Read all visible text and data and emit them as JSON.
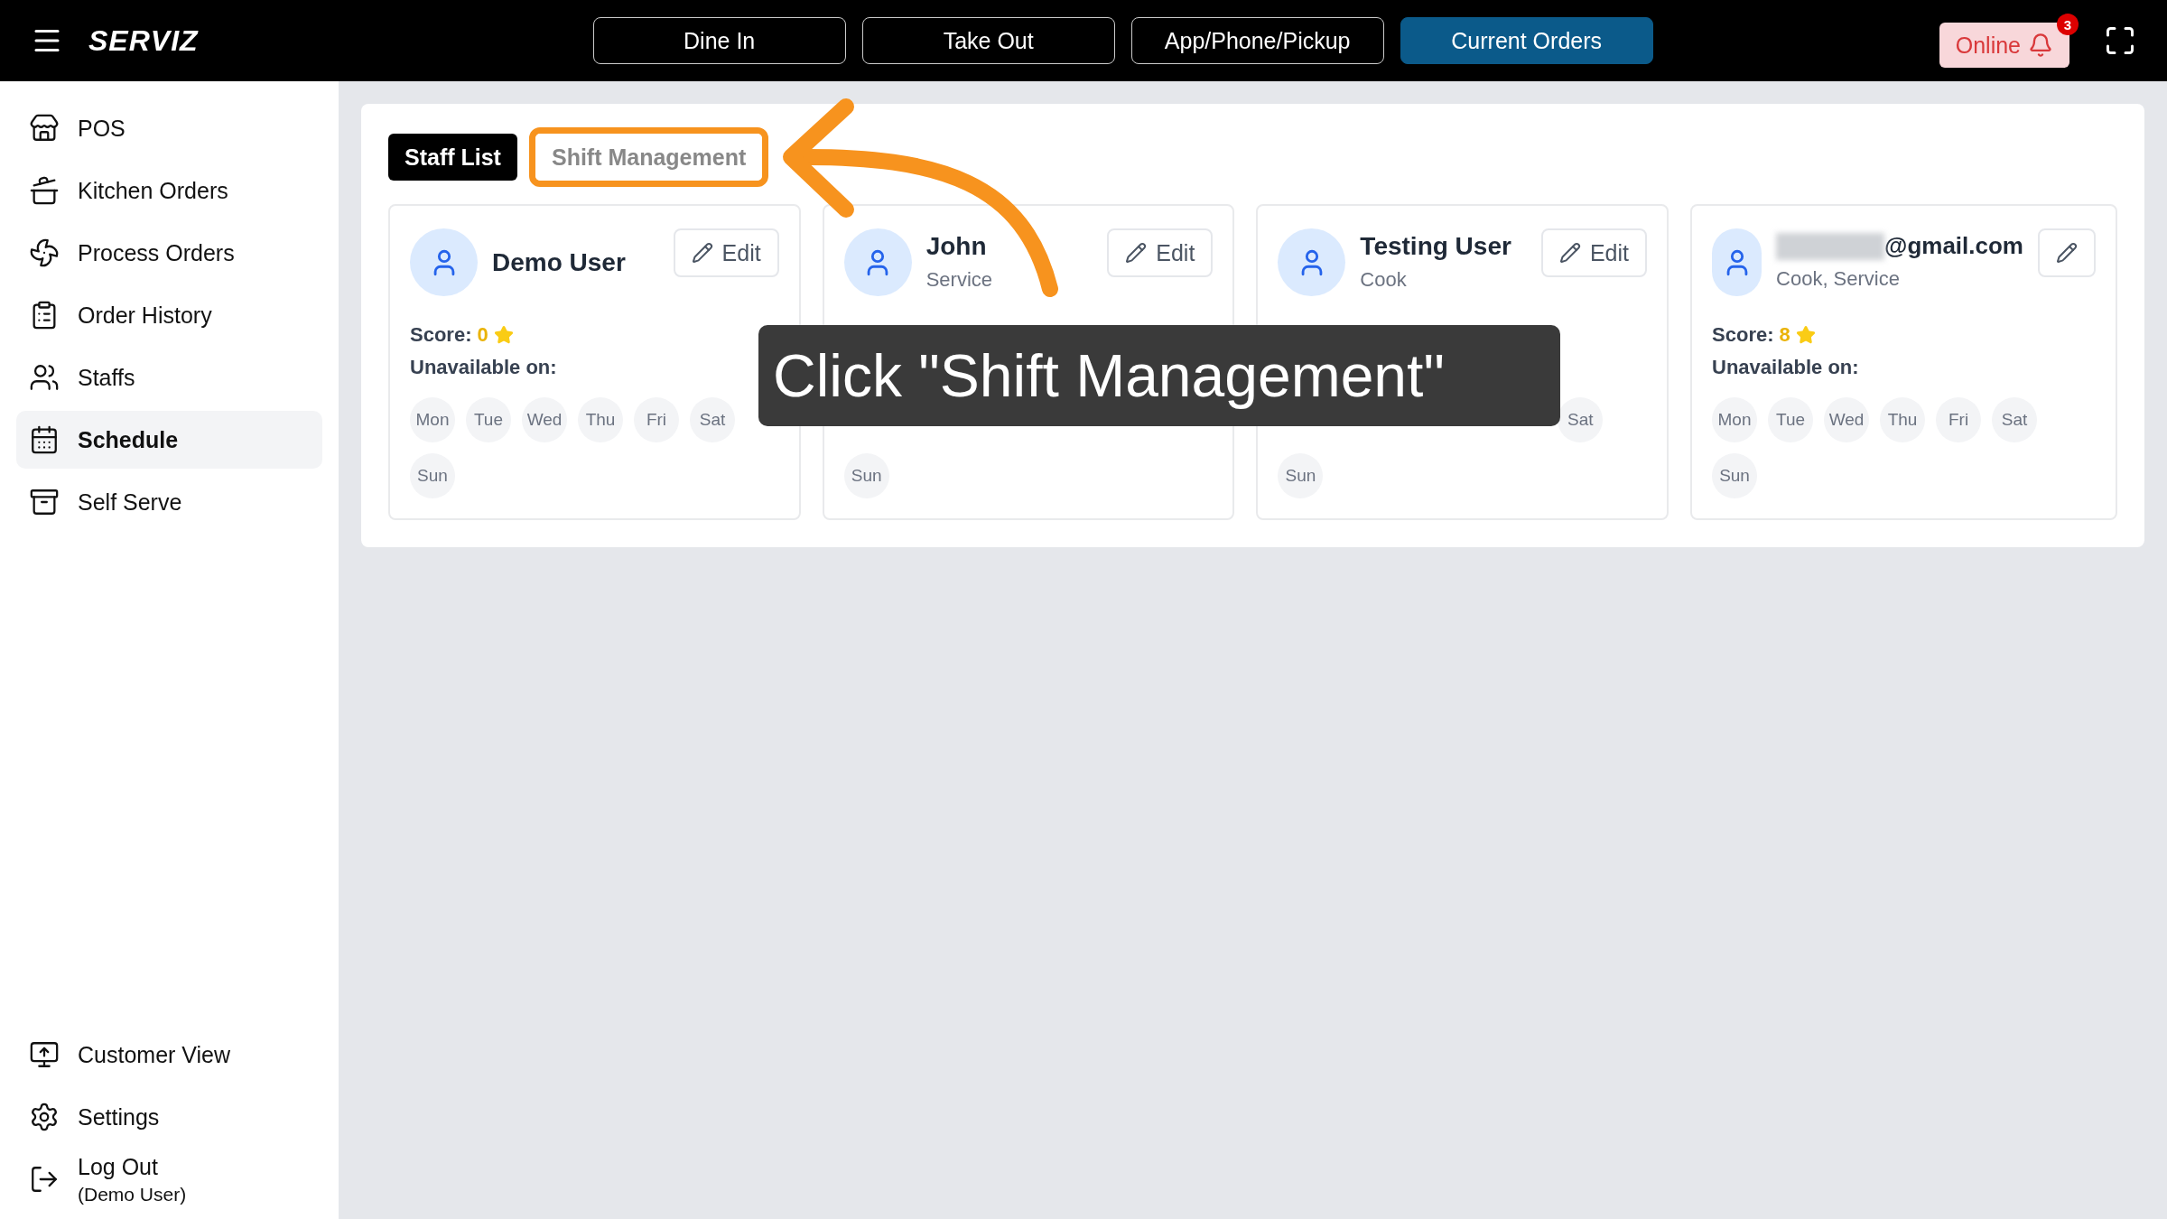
{
  "header": {
    "brand": "SERVIZ",
    "order_types": [
      {
        "label": "Dine In",
        "selected": false
      },
      {
        "label": "Take Out",
        "selected": false
      },
      {
        "label": "App/Phone/Pickup",
        "selected": false
      },
      {
        "label": "Current Orders",
        "selected": true
      }
    ],
    "status": "Online",
    "notification_count": "3"
  },
  "sidebar": {
    "items": [
      {
        "label": "POS",
        "selected": false
      },
      {
        "label": "Kitchen Orders",
        "selected": false
      },
      {
        "label": "Process Orders",
        "selected": false
      },
      {
        "label": "Order History",
        "selected": false
      },
      {
        "label": "Staffs",
        "selected": false
      },
      {
        "label": "Schedule",
        "selected": true
      },
      {
        "label": "Self Serve",
        "selected": false
      }
    ],
    "footer": [
      {
        "label": "Customer View"
      },
      {
        "label": "Settings"
      },
      {
        "label": "Log Out",
        "sublabel": "(Demo User)"
      }
    ]
  },
  "tabs": [
    {
      "label": "Staff List",
      "selected": true,
      "highlighted": false
    },
    {
      "label": "Shift Management",
      "selected": false,
      "highlighted": true
    }
  ],
  "staff": [
    {
      "name": "Demo User",
      "redacted": false,
      "score_label": "Score:",
      "score": "0",
      "unavailable_label": "Unavailable on:",
      "edit": "Edit",
      "days": [
        {
          "label": "Mon",
          "unavailable": false
        },
        {
          "label": "Tue",
          "unavailable": false
        },
        {
          "label": "Wed",
          "unavailable": false
        },
        {
          "label": "Thu",
          "unavailable": false
        },
        {
          "label": "Fri",
          "unavailable": false
        },
        {
          "label": "Sat",
          "unavailable": false
        },
        {
          "label": "Sun",
          "unavailable": false
        }
      ]
    },
    {
      "name": "John",
      "redacted": false,
      "role": "Service",
      "edit": "Edit",
      "days": [
        {
          "label": "Sun",
          "unavailable": false
        }
      ]
    },
    {
      "name": "Testing User",
      "redacted": false,
      "role": "Cook",
      "edit": "Edit",
      "days": [
        {
          "label": "Sat",
          "unavailable": false
        },
        {
          "label": "Sun",
          "unavailable": false
        }
      ]
    },
    {
      "name": "@gmail.com",
      "redacted": true,
      "role": "Cook, Service",
      "score_label": "Score:",
      "score": "8",
      "unavailable_label": "Unavailable on:",
      "days": [
        {
          "label": "Mon",
          "unavailable": false
        },
        {
          "label": "Tue",
          "unavailable": false
        },
        {
          "label": "Wed",
          "unavailable": false
        },
        {
          "label": "Thu",
          "unavailable": false
        },
        {
          "label": "Fri",
          "unavailable": false
        },
        {
          "label": "Sat",
          "unavailable": false
        },
        {
          "label": "Sun",
          "unavailable": false
        }
      ]
    }
  ],
  "annotation": {
    "callout": "Click \"Shift Management\""
  }
}
